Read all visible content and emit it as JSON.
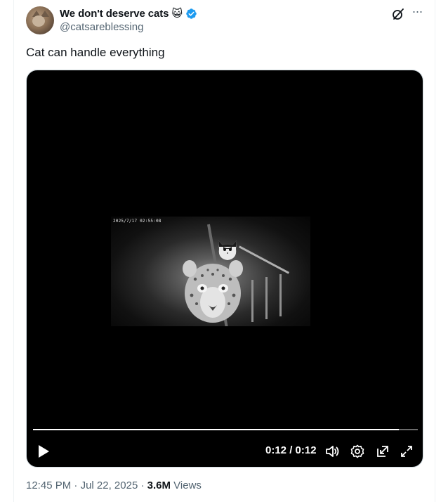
{
  "author": {
    "display_name": "We don't deserve cats",
    "emoji": "😺",
    "handle": "@catsareblessing"
  },
  "tweet": {
    "text": "Cat can handle everything",
    "time": "12:45 PM",
    "separator": "·",
    "date": "Jul 22, 2025",
    "views_count": "3.6M",
    "views_label": "Views"
  },
  "video": {
    "timestamp_overlay": "2025/7/17  02:55:08",
    "time_display": "0:12 / 0:12",
    "progress": 0.95
  },
  "icons": {
    "verified": "verified-badge-icon",
    "grok": "grok-icon",
    "more": "more-icon",
    "play": "play-icon",
    "volume": "volume-icon",
    "settings": "settings-icon",
    "dock": "pop-out-icon",
    "fullscreen": "fullscreen-icon"
  },
  "colors": {
    "verified_blue": "#1d9bf0",
    "muted_text": "#536471"
  }
}
